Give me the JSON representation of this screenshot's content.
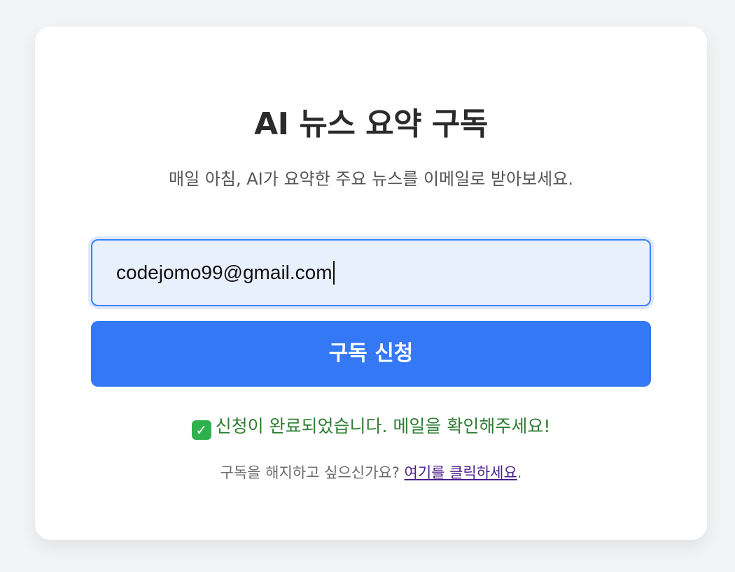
{
  "card": {
    "title": "AI 뉴스 요약 구독",
    "subtitle": "매일 아침, AI가 요약한 주요 뉴스를 이메일로 받아보세요."
  },
  "form": {
    "email_value": "codejomo99@gmail.com",
    "submit_label": "구독 신청"
  },
  "status": {
    "icon": "check-mark-button-icon",
    "message": "신청이 완료되었습니다. 메일을 확인해주세요!"
  },
  "unsubscribe": {
    "prompt": "구독을 해지하고 싶으신가요? ",
    "link_text": "여기를 클릭하세요",
    "suffix": "."
  },
  "colors": {
    "accent": "#3478f6",
    "success": "#2e7d32",
    "link": "#4a1f8a"
  }
}
